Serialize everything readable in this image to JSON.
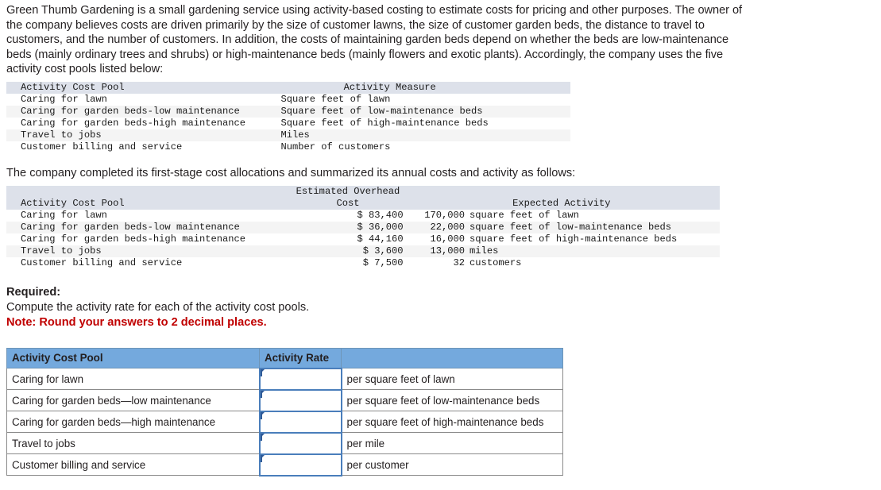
{
  "intro": {
    "paragraph": "Green Thumb Gardening is a small gardening service using activity-based costing to estimate costs for pricing and other purposes. The owner of the company believes costs are driven primarily by the size of customer lawns, the size of customer garden beds, the distance to travel to customers, and the number of customers. In addition, the costs of maintaining garden beds depend on whether the beds are low-maintenance beds (mainly ordinary trees and shrubs) or high-maintenance beds (mainly flowers and exotic plants). Accordingly, the company uses the five activity cost pools listed below:",
    "second_paragraph": "The company completed its first-stage cost allocations and summarized its annual costs and activity as follows:"
  },
  "table_activity_measures": {
    "headers": {
      "pool": "Activity Cost Pool",
      "measure": "Activity Measure"
    },
    "rows": [
      {
        "pool": "Caring for lawn",
        "measure": "Square feet of lawn"
      },
      {
        "pool": "Caring for garden beds-low maintenance",
        "measure": "Square feet of low-maintenance beds"
      },
      {
        "pool": "Caring for garden beds-high maintenance",
        "measure": "Square feet of high-maintenance beds"
      },
      {
        "pool": "Travel to jobs",
        "measure": "Miles"
      },
      {
        "pool": "Customer billing and service",
        "measure": "Number of customers"
      }
    ]
  },
  "table_costs": {
    "headers": {
      "pool": "Activity Cost Pool",
      "cost_line1": "Estimated Overhead",
      "cost_line2": "Cost",
      "activity": "Expected Activity"
    },
    "rows": [
      {
        "pool": "Caring for lawn",
        "cost": "$ 83,400",
        "qty": "170,000",
        "unit": "square feet of lawn"
      },
      {
        "pool": "Caring for garden beds-low maintenance",
        "cost": "$ 36,000",
        "qty": "22,000",
        "unit": "square feet of low-maintenance beds"
      },
      {
        "pool": "Caring for garden beds-high maintenance",
        "cost": "$ 44,160",
        "qty": "16,000",
        "unit": "square feet of high-maintenance beds"
      },
      {
        "pool": "Travel to jobs",
        "cost": "$ 3,600",
        "qty": "13,000",
        "unit": "miles"
      },
      {
        "pool": "Customer billing and service",
        "cost": "$ 7,500",
        "qty": "32",
        "unit": "customers"
      }
    ]
  },
  "required": {
    "label": "Required:",
    "text": "Compute the activity rate for each of the activity cost pools.",
    "note": "Note: Round your answers to 2 decimal places."
  },
  "answer_table": {
    "headers": {
      "pool": "Activity Cost Pool",
      "rate": "Activity Rate",
      "unit": ""
    },
    "rows": [
      {
        "pool": "Caring for lawn",
        "rate": "",
        "unit": "per square feet of lawn"
      },
      {
        "pool": "Caring for garden beds—low maintenance",
        "rate": "",
        "unit": "per square feet of low-maintenance beds"
      },
      {
        "pool": "Caring for garden beds—high maintenance",
        "rate": "",
        "unit": "per square feet of high-maintenance beds"
      },
      {
        "pool": "Travel to jobs",
        "rate": "",
        "unit": "per mile"
      },
      {
        "pool": "Customer billing and service",
        "rate": "",
        "unit": "per customer"
      }
    ]
  },
  "colors": {
    "header_blue": "#74a9dd",
    "mono_header_bg": "#dde1ea",
    "row_shade": "#f4f4f4",
    "note_red": "#c00000",
    "input_border": "#4a7ebb",
    "flag_blue": "#2f5a97"
  }
}
